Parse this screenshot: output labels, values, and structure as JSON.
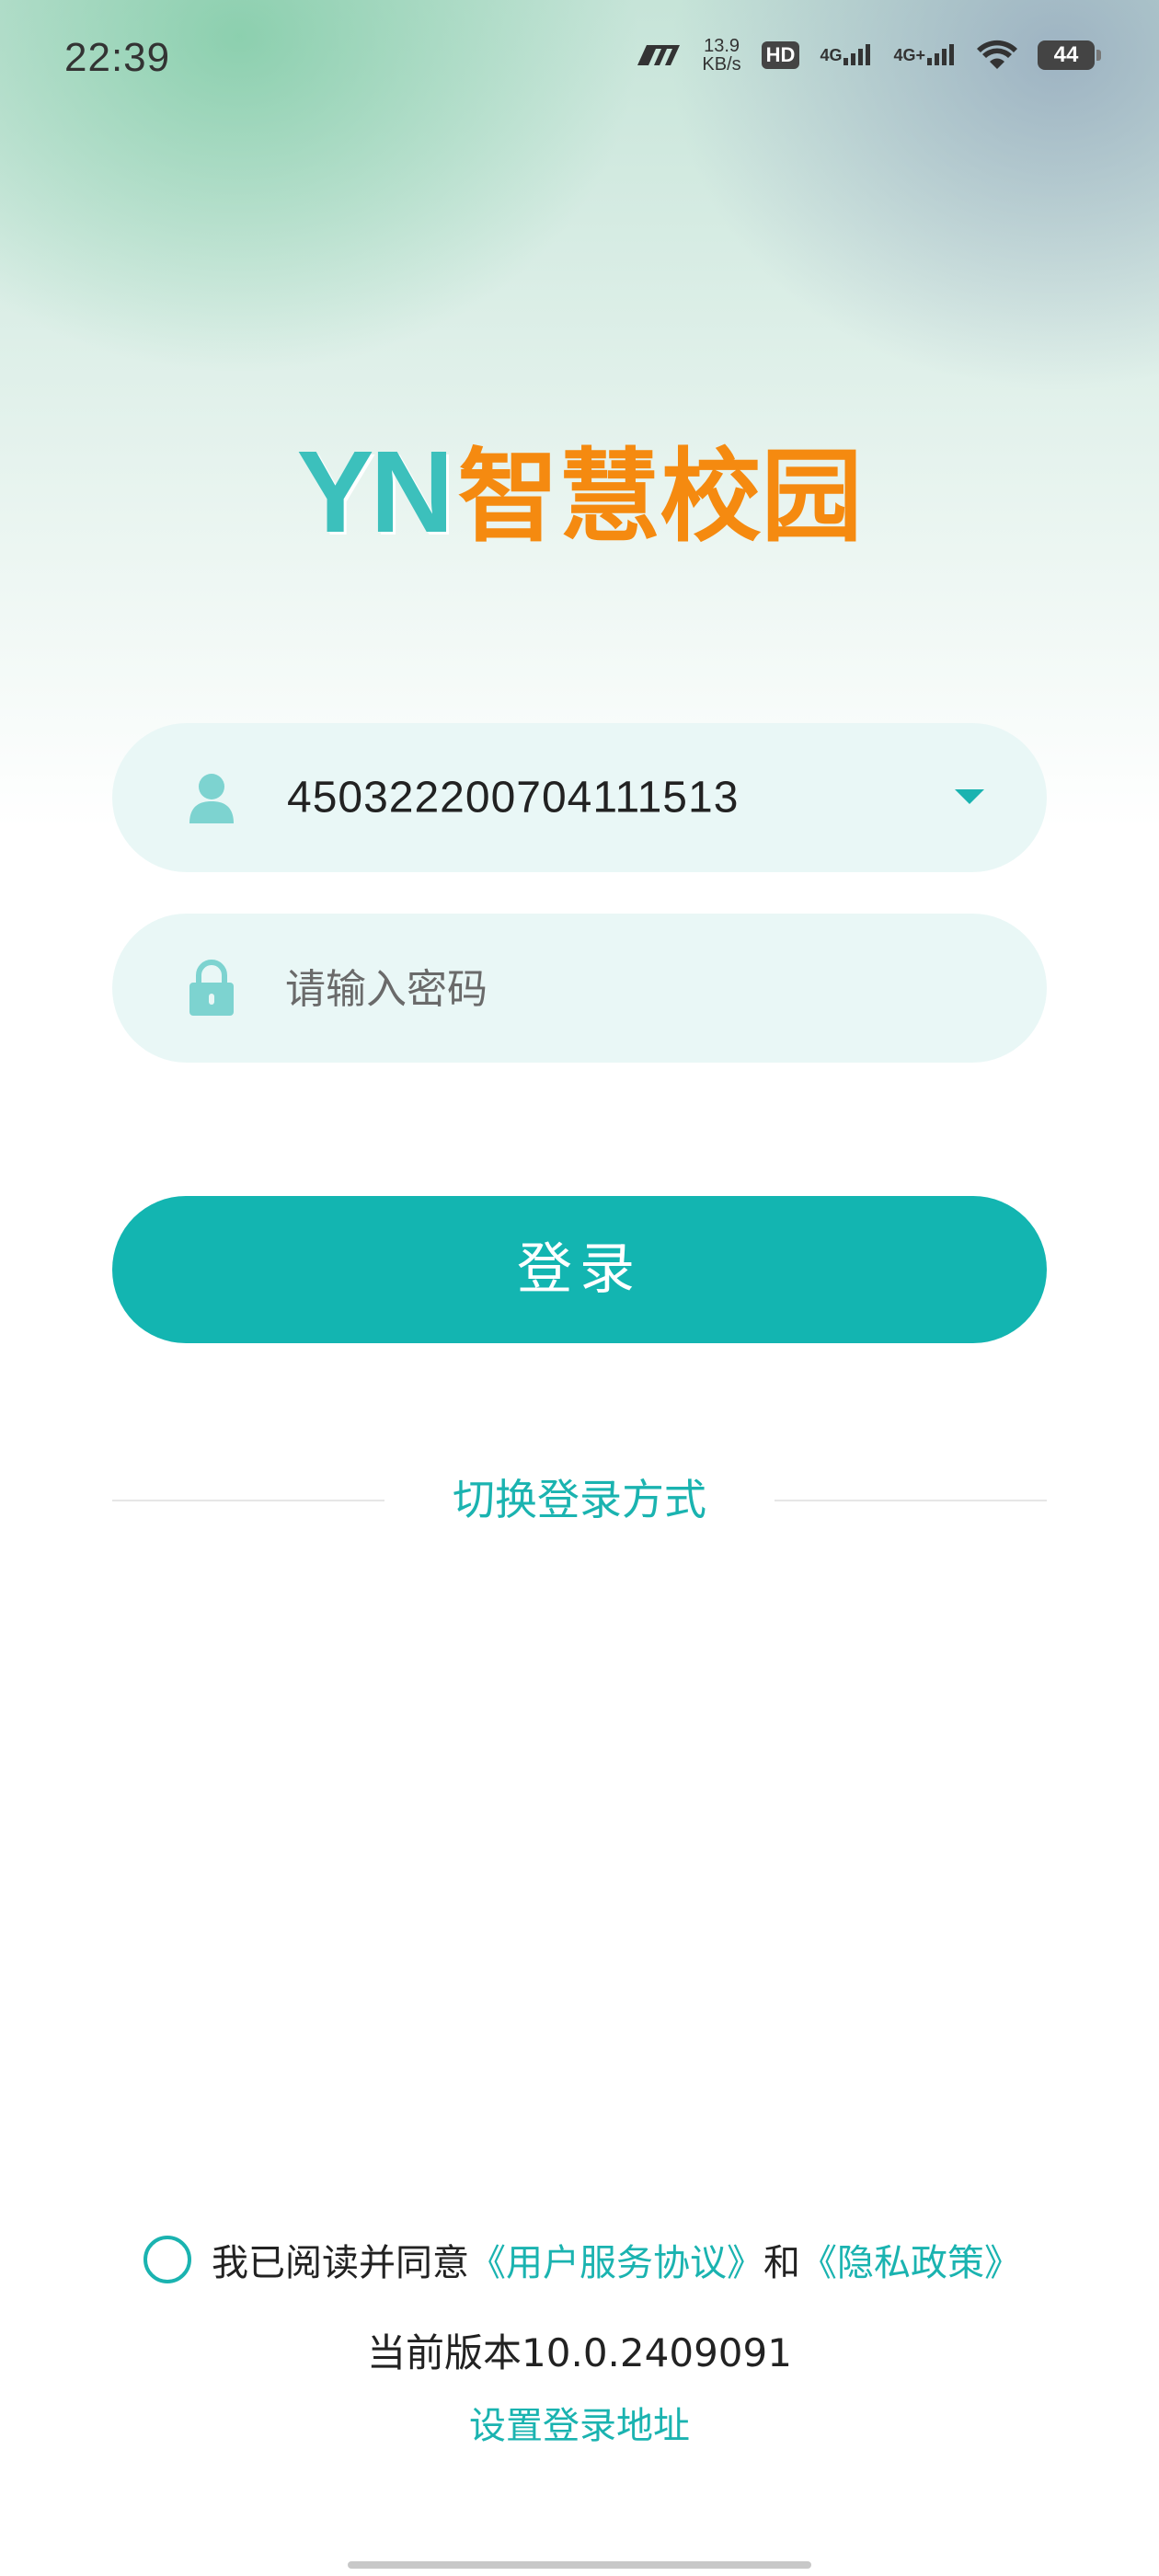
{
  "status_bar": {
    "time": "22:39",
    "net_speed_value": "13.9",
    "net_speed_unit": "KB/s",
    "hd_label": "HD",
    "signal_1_label": "4G",
    "signal_2_label": "4G+",
    "battery": "44"
  },
  "logo": {
    "latin": "YN",
    "chinese": "智慧校园"
  },
  "login_form": {
    "account_value": "450322200704111513",
    "password_placeholder": "请输入密码",
    "login_label": "登录",
    "switch_label": "切换登录方式"
  },
  "footer": {
    "agree_prefix": "我已阅读并同意",
    "terms_link": "《用户服务协议》",
    "and_text": "和",
    "privacy_link": "《隐私政策》",
    "version_text": "当前版本10.0.2409091",
    "server_link": "设置登录地址"
  },
  "colors": {
    "accent": "#13b5b1",
    "logo_teal": "#3cc0bc",
    "logo_orange": "#f58a10",
    "field_bg": "#e9f7f6"
  },
  "icons": [
    "user-icon",
    "lock-icon",
    "dropdown-icon",
    "radio-unchecked-icon"
  ]
}
